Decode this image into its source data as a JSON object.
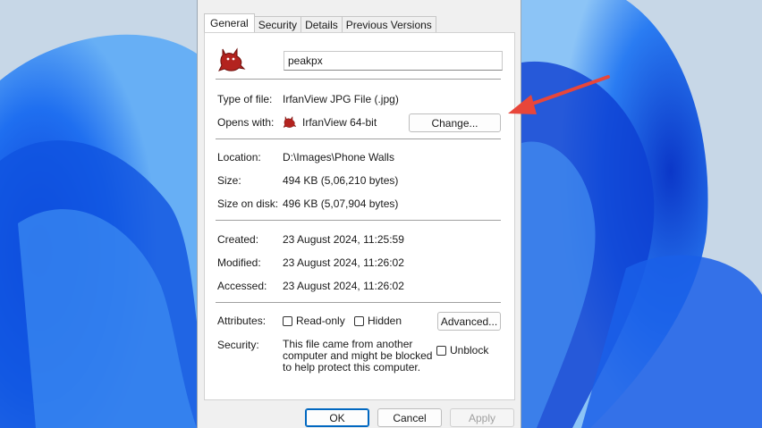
{
  "tabs": [
    "General",
    "Security",
    "Details",
    "Previous Versions"
  ],
  "active_tab": "General",
  "file": {
    "name": "peakpx",
    "type_label": "Type of file:",
    "type_value": "IrfanView JPG File (.jpg)",
    "opens_label": "Opens with:",
    "opens_value": "IrfanView 64-bit",
    "change_button": "Change...",
    "location_label": "Location:",
    "location_value": "D:\\Images\\Phone Walls",
    "size_label": "Size:",
    "size_value": "494 KB (5,06,210 bytes)",
    "size_disk_label": "Size on disk:",
    "size_disk_value": "496 KB (5,07,904 bytes)",
    "created_label": "Created:",
    "created_value": "23 August 2024, 11:25:59",
    "modified_label": "Modified:",
    "modified_value": "23 August 2024, 11:26:02",
    "accessed_label": "Accessed:",
    "accessed_value": "23 August 2024, 11:26:02",
    "attributes_label": "Attributes:",
    "readonly_label": "Read-only",
    "hidden_label": "Hidden",
    "advanced_button": "Advanced...",
    "security_label": "Security:",
    "security_text": "This file came from another computer and might be blocked to help protect this computer.",
    "unblock_label": "Unblock"
  },
  "footer": {
    "ok": "OK",
    "cancel": "Cancel",
    "apply": "Apply"
  },
  "icons": {
    "file_icon": "irfanview-cat-icon",
    "app_icon": "irfanview-cat-icon",
    "annotation": "red-arrow-icon"
  },
  "colors": {
    "accent": "#0067c0",
    "arrow": "#e8463a",
    "icon_red": "#b3231f"
  }
}
